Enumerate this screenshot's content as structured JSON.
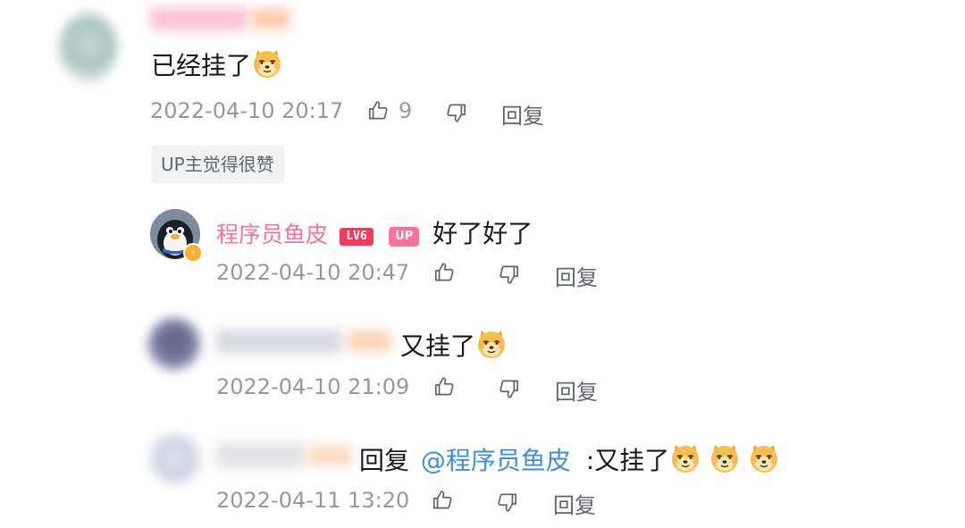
{
  "main_comment": {
    "content": "已经挂了",
    "date": "2022-04-10 20:17",
    "like_count": "9",
    "reply_label": "回复",
    "up_tag": "UP主觉得很赞"
  },
  "replies": [
    {
      "username": "程序员鱼皮",
      "level": "LV6",
      "up_badge": "UP",
      "content": "好了好了",
      "date": "2022-04-10 20:47",
      "reply_label": "回复"
    },
    {
      "content": "又挂了",
      "date": "2022-04-10 21:09",
      "reply_label": "回复"
    },
    {
      "reply_prefix": "回复",
      "mention": "@程序员鱼皮",
      "content": ":又挂了",
      "date": "2022-04-11 13:20",
      "reply_label": "回复"
    }
  ],
  "icons": {
    "like": "thumbs-up-icon",
    "dislike": "thumbs-down-icon",
    "emoji": "doge-emoji"
  },
  "colors": {
    "username_pink": "#fb7299",
    "mention_blue": "#3f8fd6",
    "meta_gray": "#9499a0"
  }
}
